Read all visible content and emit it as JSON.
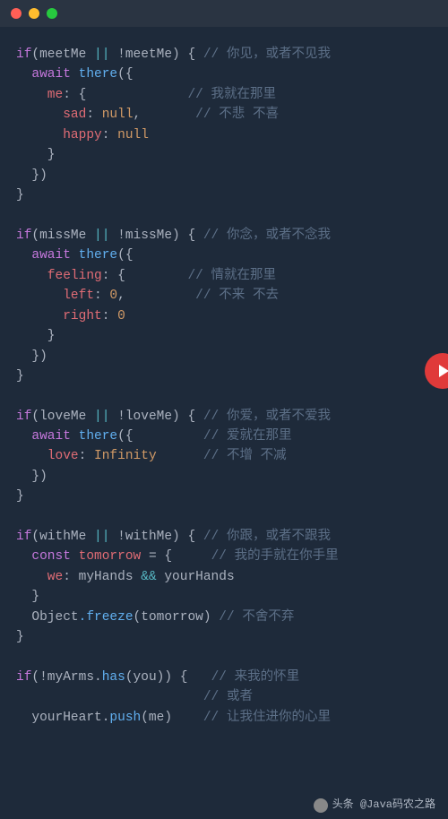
{
  "titlebar": {
    "dots": [
      "red",
      "yellow",
      "green"
    ]
  },
  "code": {
    "b1": {
      "l1a": "if",
      "l1b": "(meetMe ",
      "l1c": "||",
      "l1d": " !meetMe) { ",
      "l1e": "// 你见，或者不见我",
      "l2a": "  await",
      "l2b": " there",
      "l2c": "({",
      "l3a": "    me",
      "l3b": ": {",
      "l3c": "// 我就在那里",
      "l4a": "      sad",
      "l4b": ": ",
      "l4c": "null",
      "l4d": ",",
      "l4e": "// 不悲 不喜",
      "l5a": "      happy",
      "l5b": ": ",
      "l5c": "null",
      "l6": "    }",
      "l7": "  })",
      "l8": "}"
    },
    "b2": {
      "l1a": "if",
      "l1b": "(missMe ",
      "l1c": "||",
      "l1d": " !missMe) { ",
      "l1e": "// 你念，或者不念我",
      "l2a": "  await",
      "l2b": " there",
      "l2c": "({",
      "l3a": "    feeling",
      "l3b": ": {",
      "l3c": "// 情就在那里",
      "l4a": "      left",
      "l4b": ": ",
      "l4c": "0",
      "l4d": ",",
      "l4e": "// 不来 不去",
      "l5a": "      right",
      "l5b": ": ",
      "l5c": "0",
      "l6": "    }",
      "l7": "  })",
      "l8": "}"
    },
    "b3": {
      "l1a": "if",
      "l1b": "(loveMe ",
      "l1c": "||",
      "l1d": " !loveMe) { ",
      "l1e": "// 你爱，或者不爱我",
      "l2a": "  await",
      "l2b": " there",
      "l2c": "({",
      "l2d": "// 爱就在那里",
      "l3a": "    love",
      "l3b": ": ",
      "l3c": "Infinity",
      "l3d": "// 不增 不减",
      "l4": "  })",
      "l5": "}"
    },
    "b4": {
      "l1a": "if",
      "l1b": "(withMe ",
      "l1c": "||",
      "l1d": " !withMe) { ",
      "l1e": "// 你跟，或者不跟我",
      "l2a": "  const",
      "l2b": " tomorrow",
      "l2c": " = {",
      "l2d": "// 我的手就在你手里",
      "l3a": "    we",
      "l3b": ": myHands ",
      "l3c": "&&",
      "l3d": " yourHands",
      "l4": "  }",
      "l5a": "  Object",
      "l5b": ".freeze",
      "l5c": "(tomorrow) ",
      "l5d": "// 不舍不弃",
      "l6": "}"
    },
    "b5": {
      "l1a": "if",
      "l1b": "(!myArms.",
      "l1c": "has",
      "l1d": "(you)) {",
      "l1e": "// 来我的怀里",
      "l2": "// 或者",
      "l3a": "  yourHeart.",
      "l3b": "push",
      "l3c": "(me)",
      "l3d": "// 让我住进你的心里"
    }
  },
  "footer": {
    "label": "头条 @Java码农之路"
  }
}
